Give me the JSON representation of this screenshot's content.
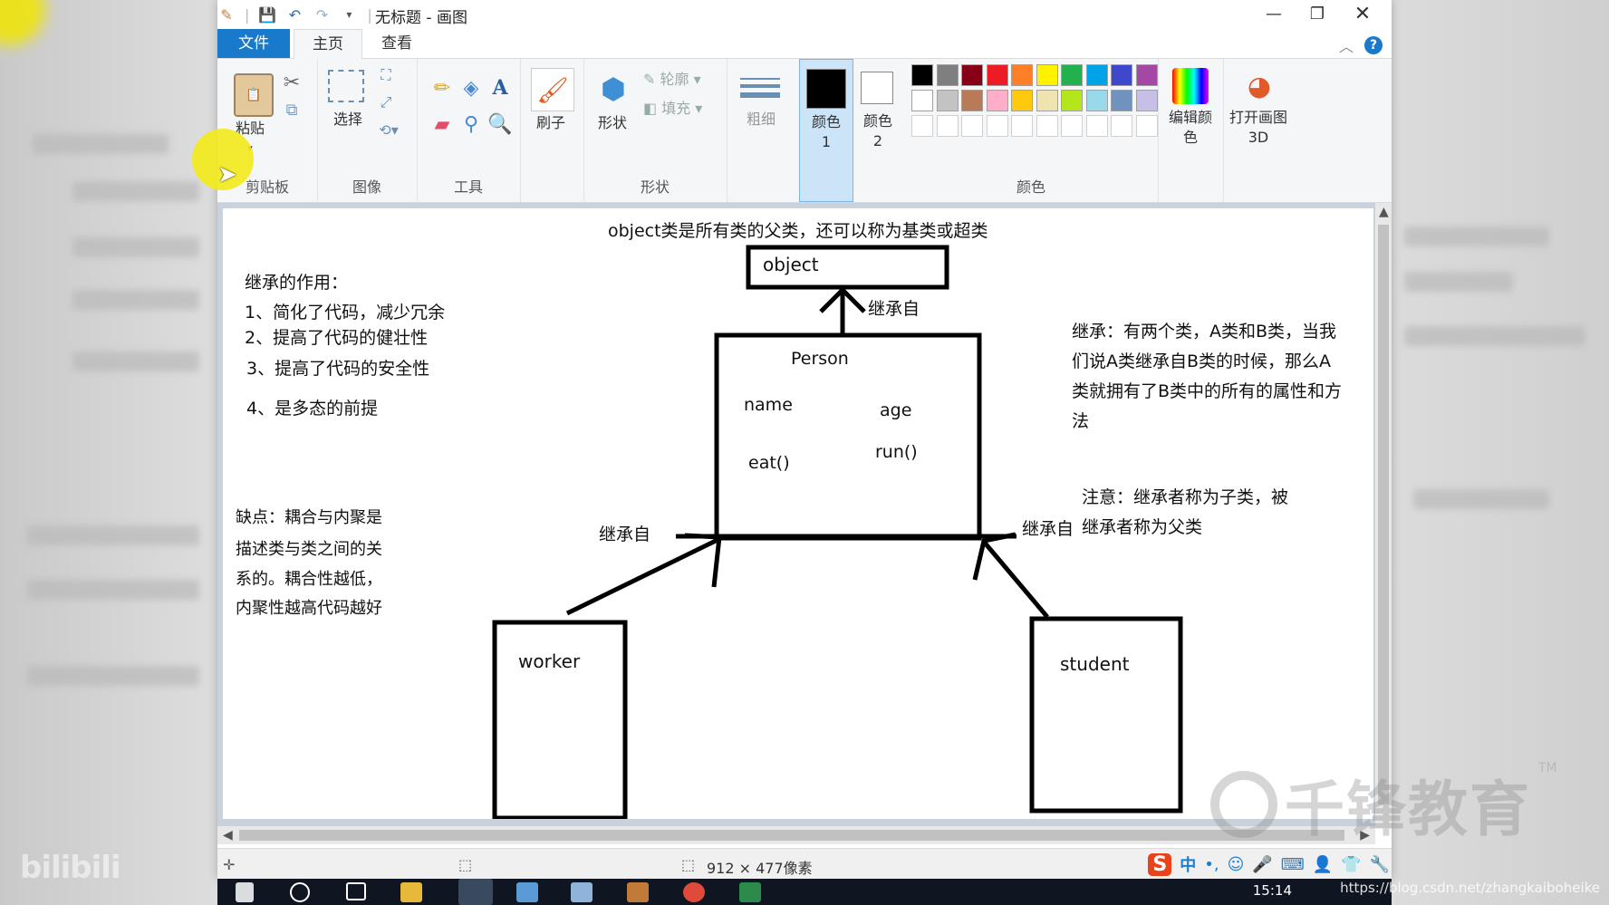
{
  "window": {
    "title": "无标题 - 画图",
    "controls": [
      "—",
      "❐",
      "✕"
    ]
  },
  "tabs": {
    "file": "文件",
    "home": "主页",
    "view": "查看"
  },
  "ribbon": {
    "clipboard": {
      "paste": "粘贴",
      "label": "剪贴板"
    },
    "image": {
      "select": "选择",
      "label": "图像"
    },
    "tools": {
      "label": "工具"
    },
    "brushes": {
      "label": "刷子"
    },
    "shapes": {
      "shapes_btn": "形状",
      "outline": "轮廓",
      "fill": "填充",
      "label": "形状"
    },
    "size": {
      "label": "粗细"
    },
    "color1": "颜色 1",
    "color2": "颜色 2",
    "colors_label": "颜色",
    "edit_colors": "编辑颜色",
    "paint3d": "打开画图 3D",
    "palette_row1": [
      "#000000",
      "#7f7f7f",
      "#880015",
      "#ed1c24",
      "#ff7f27",
      "#fff200",
      "#22b14c",
      "#00a2e8",
      "#3f48cc",
      "#a349a4"
    ],
    "palette_row2": [
      "#ffffff",
      "#c3c3c3",
      "#b97a57",
      "#ffaec9",
      "#ffc90e",
      "#efe4b0",
      "#b5e61d",
      "#99d9ea",
      "#7092be",
      "#c8bfe7"
    ]
  },
  "diagram": {
    "top_title": "object类是所有类的父类，还可以称为基类或超类",
    "object_box": "object",
    "inherit_top": "继承自",
    "person_title": "Person",
    "person_name": "name",
    "person_age": "age",
    "person_eat": "eat()",
    "person_run": "run()",
    "worker_box": "worker",
    "student_box": "student",
    "inherit_left": "继承自",
    "inherit_right": "继承自",
    "left_notes": {
      "heading": "继承的作用：",
      "items": [
        "1、简化了代码，减少冗余",
        "2、提高了代码的健壮性",
        "3、提高了代码的安全性",
        "4、是多态的前提"
      ]
    },
    "drawback": [
      "缺点：耦合与内聚是",
      "描述类与类之间的关",
      "系的。耦合性越低，",
      "内聚性越高代码越好"
    ],
    "right_notes": [
      "继承：有两个类，A类和B类，当我",
      "们说A类继承自B类的时候，那么A",
      "类就拥有了B类中的所有的属性和方",
      "法"
    ],
    "note2": [
      "注意：继承者称为子类，被",
      "继承者称为父类"
    ]
  },
  "status": {
    "canvas_size": "912 × 477像素"
  },
  "taskbar": {
    "clock": "15:14"
  },
  "watermark": {
    "brand": "千锋教育",
    "tm": "TM",
    "url": "https://blog.csdn.net/zhangkaiboheike"
  }
}
